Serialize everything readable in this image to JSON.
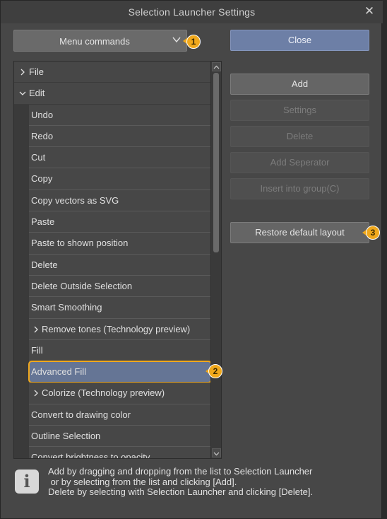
{
  "window": {
    "title": "Selection Launcher Settings",
    "close_icon": "close-icon"
  },
  "dropdown": {
    "label": "Menu commands",
    "icon": "chevron-down-icon"
  },
  "callouts": [
    "1",
    "2",
    "3"
  ],
  "list": {
    "rows": [
      {
        "kind": "top",
        "expanded": false,
        "label": "File"
      },
      {
        "kind": "top",
        "expanded": true,
        "label": "Edit"
      },
      {
        "kind": "child",
        "label": "Undo"
      },
      {
        "kind": "child",
        "label": "Redo"
      },
      {
        "kind": "child",
        "label": "Cut"
      },
      {
        "kind": "child",
        "label": "Copy"
      },
      {
        "kind": "child",
        "label": "Copy vectors as SVG"
      },
      {
        "kind": "child",
        "label": "Paste"
      },
      {
        "kind": "child",
        "label": "Paste to shown position"
      },
      {
        "kind": "child",
        "label": "Delete"
      },
      {
        "kind": "child",
        "label": "Delete Outside Selection"
      },
      {
        "kind": "child",
        "label": "Smart Smoothing"
      },
      {
        "kind": "sub",
        "label": "Remove tones (Technology preview)"
      },
      {
        "kind": "child",
        "label": "Fill"
      },
      {
        "kind": "child",
        "label": "Advanced Fill",
        "selected": true
      },
      {
        "kind": "sub",
        "label": "Colorize (Technology preview)"
      },
      {
        "kind": "child",
        "label": "Convert to drawing color"
      },
      {
        "kind": "child",
        "label": "Outline Selection"
      },
      {
        "kind": "child",
        "label": "Convert brightness to opacity"
      }
    ]
  },
  "buttons": {
    "close": "Close",
    "add": "Add",
    "settings": "Settings",
    "delete": "Delete",
    "add_separator": "Add Seperator",
    "insert_group": "Insert into group(C)",
    "restore": "Restore default layout"
  },
  "info": {
    "icon": "info-icon",
    "text": "Add by dragging and dropping from the list to Selection Launcher\n or by selecting from the list and clicking [Add].\nDelete by selecting with Selection Launcher and clicking [Delete]."
  },
  "colors": {
    "accent": "#6d7fa6",
    "selection": "#657595",
    "callout": "#f0a81c",
    "background": "#474747"
  }
}
